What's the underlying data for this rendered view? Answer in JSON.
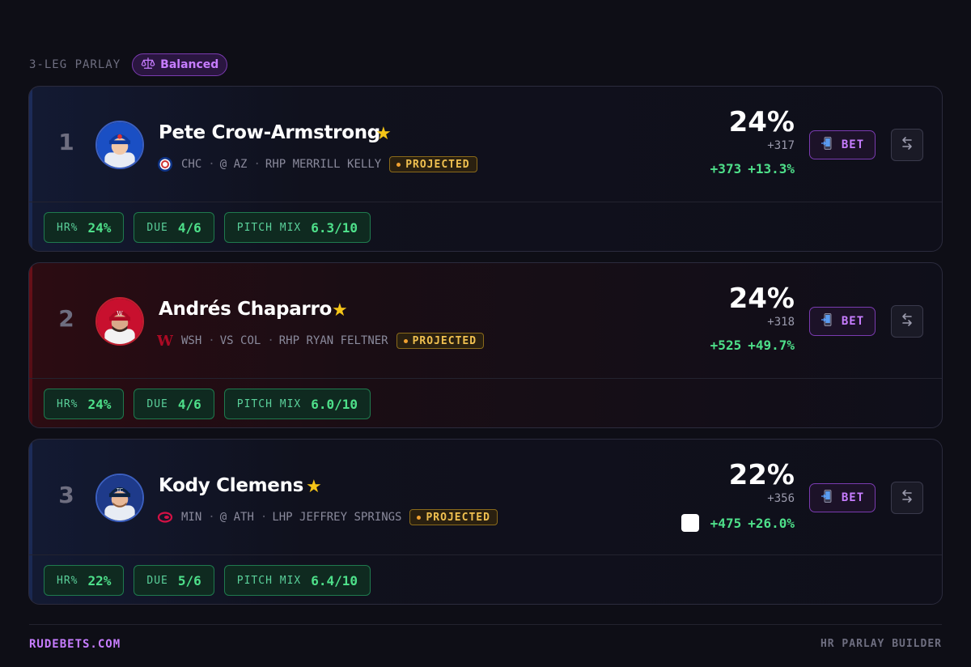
{
  "header": {
    "label": "3-LEG PARLAY",
    "strategy": "Balanced",
    "strategy_icon": "scale-icon"
  },
  "legs": [
    {
      "rank": "1",
      "name": "Pete Crow-Armstrong",
      "team": "CHC",
      "opponent": "@ AZ",
      "pitcher": "RHP MERRILL KELLY",
      "status": "PROJECTED",
      "probability": "24%",
      "american_odds": "+317",
      "book_odds": "+373",
      "edge": "+13.3%",
      "bet_label": "BET",
      "metrics": [
        {
          "label": "HR%",
          "value": "24%"
        },
        {
          "label": "DUE",
          "value": "4/6"
        },
        {
          "label": "PITCH MIX",
          "value": "6.3/10"
        }
      ]
    },
    {
      "rank": "2",
      "name": "Andrés Chaparro",
      "team": "WSH",
      "opponent": "VS COL",
      "pitcher": "RHP RYAN FELTNER",
      "status": "PROJECTED",
      "probability": "24%",
      "american_odds": "+318",
      "book_odds": "+525",
      "edge": "+49.7%",
      "bet_label": "BET",
      "metrics": [
        {
          "label": "HR%",
          "value": "24%"
        },
        {
          "label": "DUE",
          "value": "4/6"
        },
        {
          "label": "PITCH MIX",
          "value": "6.0/10"
        }
      ]
    },
    {
      "rank": "3",
      "name": "Kody Clemens",
      "team": "MIN",
      "opponent": "@ ATH",
      "pitcher": "LHP JEFFREY SPRINGS",
      "status": "PROJECTED",
      "probability": "22%",
      "american_odds": "+356",
      "book_odds": "+475",
      "edge": "+26.0%",
      "bet_label": "BET",
      "metrics": [
        {
          "label": "HR%",
          "value": "22%"
        },
        {
          "label": "DUE",
          "value": "5/6"
        },
        {
          "label": "PITCH MIX",
          "value": "6.4/10"
        }
      ]
    }
  ],
  "footer": {
    "brand": "RUDEBETS.COM",
    "tool": "HR PARLAY BUILDER"
  },
  "colors": {
    "accent": "#c77dff",
    "positive": "#4ee08a",
    "star": "#f5c518",
    "projected": "#f0c050"
  }
}
